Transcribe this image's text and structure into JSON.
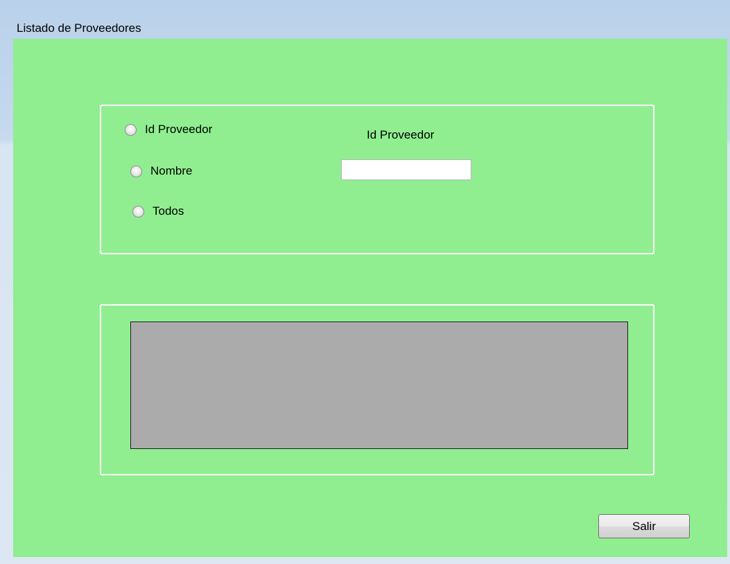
{
  "window": {
    "title": "Listado de Proveedores"
  },
  "search_group": {
    "options": [
      {
        "label": "Id Proveedor",
        "selected": false
      },
      {
        "label": "Nombre",
        "selected": false
      },
      {
        "label": "Todos",
        "selected": false
      }
    ],
    "field_label": "Id Proveedor",
    "field_value": ""
  },
  "actions": {
    "exit_label": "Salir"
  },
  "colors": {
    "form_background": "#90ee90",
    "grid_background": "#ababab"
  }
}
